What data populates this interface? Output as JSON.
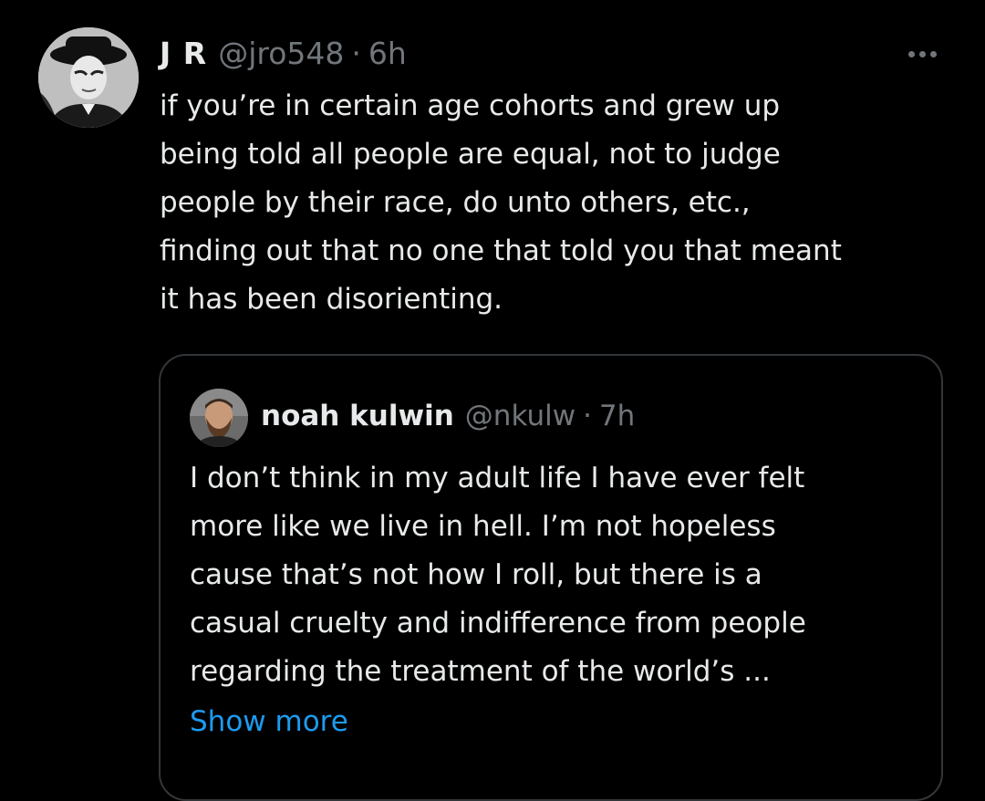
{
  "tweet": {
    "author": {
      "display_name": "J R",
      "handle": "@jro548",
      "separator": "·",
      "time": "6h"
    },
    "text_lines": [
      "if you’re in certain age cohorts and grew up",
      "being told all people are equal, not to judge",
      "people by their race, do unto others, etc.,",
      "finding out that no one that told you that meant",
      "it has been disorienting."
    ],
    "more_icon": "more-horizontal-icon"
  },
  "quote": {
    "author": {
      "display_name": "noah kulwin",
      "handle": "@nkulw",
      "separator": "·",
      "time": "7h"
    },
    "text_lines": [
      "I don’t think in my adult life I have ever felt",
      "more like we live in hell. I’m not hopeless",
      "cause that’s not how I roll, but there is a",
      "casual cruelty and indifference from people",
      "regarding the treatment of the world’s ..."
    ],
    "show_more_label": "Show more"
  },
  "colors": {
    "background": "#000000",
    "primary_text": "#e7e9ea",
    "secondary_text": "#71767b",
    "link": "#1d9bf0",
    "border": "#333639"
  }
}
